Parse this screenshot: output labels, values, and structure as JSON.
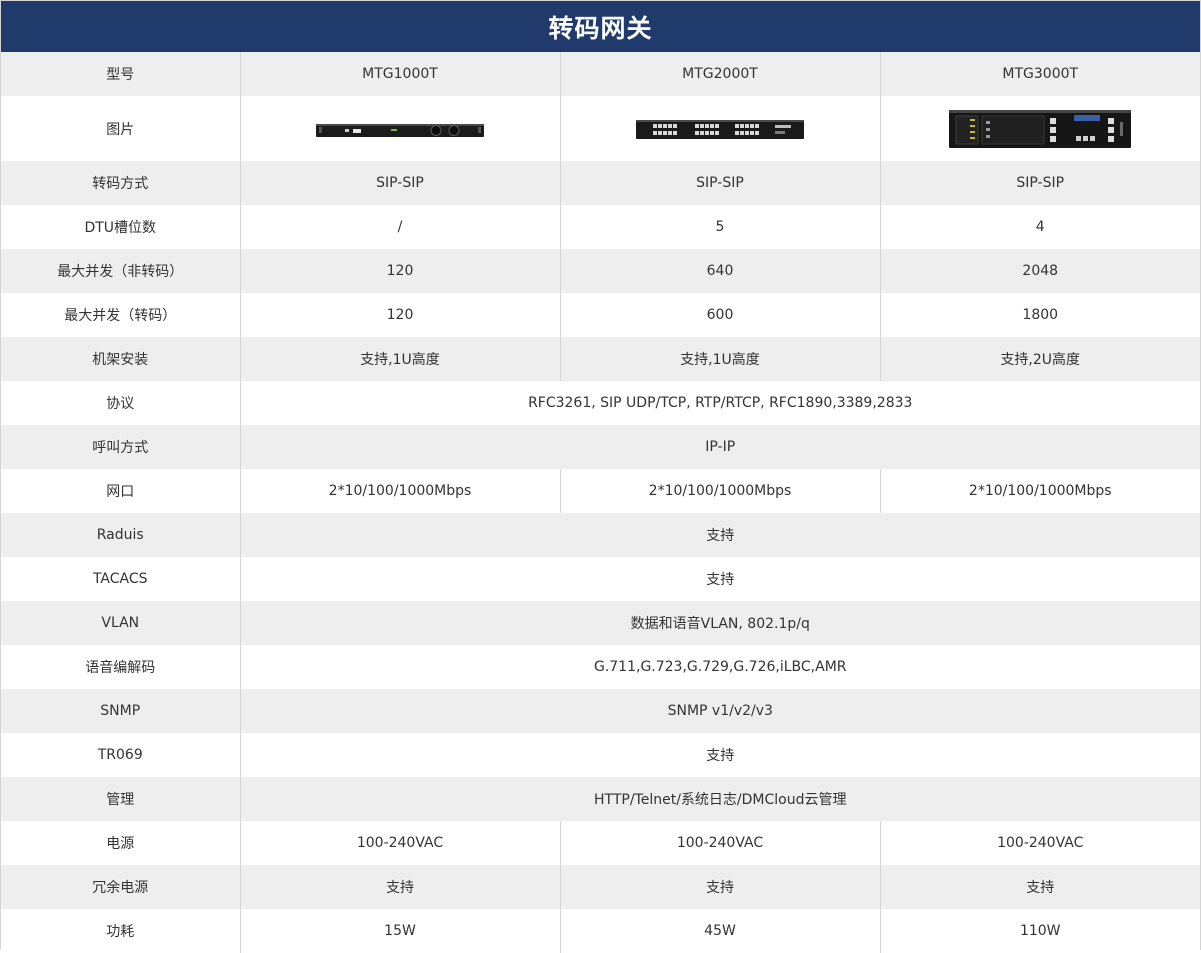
{
  "title": "转码网关",
  "colors": {
    "title_bg": "#1f3a6b",
    "row_shade": "#eeeeee",
    "row_plain": "#ffffff",
    "text": "#333333"
  },
  "header": {
    "label": "型号",
    "models": [
      "MTG1000T",
      "MTG2000T",
      "MTG3000T"
    ]
  },
  "image_row": {
    "label": "图片",
    "images": [
      "mtg1000t-device-image",
      "mtg2000t-device-image",
      "mtg3000t-device-image"
    ]
  },
  "rows": [
    {
      "label": "转码方式",
      "values": [
        "SIP-SIP",
        "SIP-SIP",
        "SIP-SIP"
      ]
    },
    {
      "label": "DTU槽位数",
      "values": [
        "/",
        "5",
        "4"
      ]
    },
    {
      "label": "最大并发（非转码）",
      "values": [
        "120",
        "640",
        "2048"
      ]
    },
    {
      "label": "最大并发（转码）",
      "values": [
        "120",
        "600",
        "1800"
      ]
    },
    {
      "label": "机架安装",
      "values": [
        "支持,1U高度",
        "支持,1U高度",
        "支持,2U高度"
      ]
    },
    {
      "label": "协议",
      "value": "RFC3261, SIP UDP/TCP, RTP/RTCP, RFC1890,3389,2833"
    },
    {
      "label": "呼叫方式",
      "value": "IP-IP"
    },
    {
      "label": "网口",
      "values": [
        "2*10/100/1000Mbps",
        "2*10/100/1000Mbps",
        "2*10/100/1000Mbps"
      ]
    },
    {
      "label": "Raduis",
      "value": "支持"
    },
    {
      "label": "TACACS",
      "value": "支持"
    },
    {
      "label": "VLAN",
      "value": "数据和语音VLAN, 802.1p/q"
    },
    {
      "label": "语音编解码",
      "value": "G.711,G.723,G.729,G.726,iLBC,AMR"
    },
    {
      "label": "SNMP",
      "value": "SNMP v1/v2/v3"
    },
    {
      "label": "TR069",
      "value": "支持"
    },
    {
      "label": "管理",
      "value": "HTTP/Telnet/系统日志/DMCloud云管理"
    },
    {
      "label": "电源",
      "values": [
        "100-240VAC",
        "100-240VAC",
        "100-240VAC"
      ]
    },
    {
      "label": "冗余电源",
      "values": [
        "支持",
        "支持",
        "支持"
      ]
    },
    {
      "label": "功耗",
      "values": [
        "15W",
        "45W",
        "110W"
      ]
    }
  ]
}
